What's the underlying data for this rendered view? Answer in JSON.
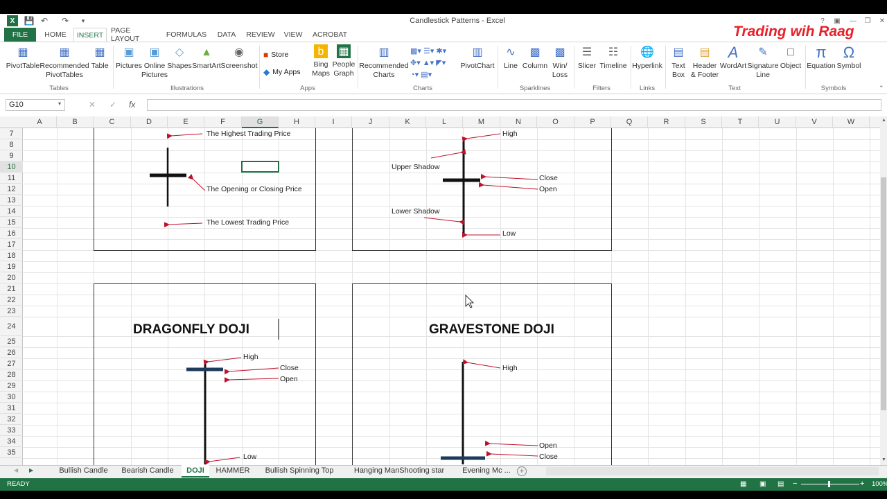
{
  "window": {
    "title": "Candlestick Patterns - Excel",
    "brand": "Trading wih Raag"
  },
  "ribbon_tabs": [
    "FILE",
    "HOME",
    "INSERT",
    "PAGE LAYOUT",
    "FORMULAS",
    "DATA",
    "REVIEW",
    "VIEW",
    "ACROBAT"
  ],
  "ribbon": {
    "pivottable": "PivotTable",
    "recommended_pivot": [
      "Recommended",
      "PivotTables"
    ],
    "table": "Table",
    "pictures": "Pictures",
    "online_pictures": [
      "Online",
      "Pictures"
    ],
    "shapes": "Shapes",
    "smartart": "SmartArt",
    "screenshot": "Screenshot",
    "store": "Store",
    "my_apps": "My Apps",
    "bing_maps": [
      "Bing",
      "Maps"
    ],
    "people_graph": [
      "People",
      "Graph"
    ],
    "recommended_charts": [
      "Recommended",
      "Charts"
    ],
    "pivotchart": "PivotChart",
    "line": "Line",
    "column": "Column",
    "winloss": [
      "Win/",
      "Loss"
    ],
    "slicer": "Slicer",
    "timeline": "Timeline",
    "hyperlink": "Hyperlink",
    "textbox": [
      "Text",
      "Box"
    ],
    "header_footer": [
      "Header",
      "& Footer"
    ],
    "wordart": "WordArt",
    "signature_line": [
      "Signature",
      "Line"
    ],
    "object": "Object",
    "equation": "Equation",
    "symbol": "Symbol",
    "groups": [
      "Tables",
      "Illustrations",
      "Apps",
      "Charts",
      "Sparklines",
      "Filters",
      "Links",
      "Text",
      "Symbols"
    ]
  },
  "formula_bar": {
    "name_box": "G10",
    "fx": "fx",
    "value": ""
  },
  "columns": [
    "A",
    "B",
    "C",
    "D",
    "E",
    "F",
    "G",
    "H",
    "I",
    "J",
    "K",
    "L",
    "M",
    "N",
    "O",
    "P",
    "Q",
    "R",
    "S",
    "T",
    "U",
    "V",
    "W"
  ],
  "rows": [
    "7",
    "8",
    "9",
    "10",
    "11",
    "12",
    "13",
    "14",
    "15",
    "16",
    "17",
    "18",
    "19",
    "20",
    "21",
    "22",
    "23",
    "24",
    "25",
    "26",
    "27",
    "28",
    "29",
    "30",
    "31",
    "32",
    "33",
    "34",
    "35"
  ],
  "diagram1": {
    "high": "The Highest Trading Price",
    "open_close": "The Opening or Closing Price",
    "low": "The Lowest Trading Price"
  },
  "diagram2": {
    "high": "High",
    "upper_shadow": "Upper Shadow",
    "close": "Close",
    "open": "Open",
    "lower_shadow": "Lower Shadow",
    "low": "Low"
  },
  "dragonfly": {
    "title": "DRAGONFLY DOJI",
    "high": "High",
    "close": "Close",
    "open": "Open",
    "low": "Low"
  },
  "gravestone": {
    "title": "GRAVESTONE DOJI",
    "high": "High",
    "open": "Open",
    "close": "Close"
  },
  "sheet_tabs": [
    "Bullish Candle",
    "Bearish Candle",
    "DOJI",
    "HAMMER",
    "Bullish Spinning Top",
    "Hanging ManShooting star",
    "Evening Mc ..."
  ],
  "active_sheet": "DOJI",
  "status": {
    "mode": "READY",
    "zoom": "100%"
  },
  "colors": {
    "excel_green": "#217346",
    "arrow_red": "#c0102a",
    "brand_red": "#e8202a"
  }
}
